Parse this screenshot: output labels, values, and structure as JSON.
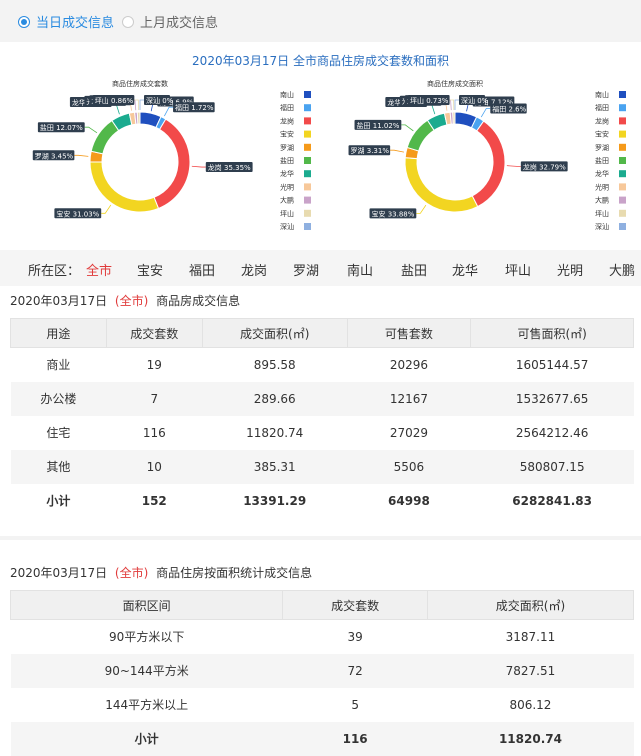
{
  "tabs": [
    {
      "label": "当日成交信息",
      "active": true
    },
    {
      "label": "上月成交信息",
      "active": false
    }
  ],
  "chart_title": "2020年03月17日 全市商品住房成交套数和面积",
  "chart_data": [
    {
      "type": "pie",
      "title": "商品住房成交套数",
      "slices": [
        {
          "name": "南山",
          "value": 6.9,
          "label": "南山 6.9%",
          "color": "#1f4fbf"
        },
        {
          "name": "福田",
          "value": 1.72,
          "label": "福田 1.72%",
          "color": "#4aa3f0"
        },
        {
          "name": "龙岗",
          "value": 35.35,
          "label": "龙岗 35.35%",
          "color": "#f24a4a"
        },
        {
          "name": "宝安",
          "value": 31.03,
          "label": "宝安 31.03%",
          "color": "#f2d521"
        },
        {
          "name": "罗湖",
          "value": 3.45,
          "label": "罗湖 3.45%",
          "color": "#f59a1a"
        },
        {
          "name": "盐田",
          "value": 12.07,
          "label": "盐田 12.07%",
          "color": "#52b84a"
        },
        {
          "name": "龙华",
          "value": 6.04,
          "label": "龙华 6.04%",
          "color": "#1bab8f"
        },
        {
          "name": "光明",
          "value": 1.72,
          "label": "光明 1.72%",
          "color": "#f7c89a"
        },
        {
          "name": "大鹏",
          "value": 0.86,
          "label": "大鹏 0.86%",
          "color": "#c9a3c9"
        },
        {
          "name": "坪山",
          "value": 0.86,
          "label": "坪山 0.86%",
          "color": "#e8dbb0"
        },
        {
          "name": "深汕",
          "value": 0,
          "label": "深汕 0%",
          "color": "#8fb0e0"
        }
      ]
    },
    {
      "type": "pie",
      "title": "商品住房成交面积",
      "slices": [
        {
          "name": "南山",
          "value": 7.12,
          "label": "南山 7.12%",
          "color": "#1f4fbf"
        },
        {
          "name": "福田",
          "value": 2.6,
          "label": "福田 2.6%",
          "color": "#4aa3f0"
        },
        {
          "name": "龙岗",
          "value": 32.79,
          "label": "龙岗 32.79%",
          "color": "#f24a4a"
        },
        {
          "name": "宝安",
          "value": 33.88,
          "label": "宝安 33.88%",
          "color": "#f2d521"
        },
        {
          "name": "罗湖",
          "value": 3.31,
          "label": "罗湖 3.31%",
          "color": "#f59a1a"
        },
        {
          "name": "盐田",
          "value": 11.02,
          "label": "盐田 11.02%",
          "color": "#52b84a"
        },
        {
          "name": "龙华",
          "value": 5.88,
          "label": "龙华 5.88%",
          "color": "#1bab8f"
        },
        {
          "name": "光明",
          "value": 1.85,
          "label": "光明 1.85%",
          "color": "#f7c89a"
        },
        {
          "name": "大鹏",
          "value": 0.82,
          "label": "大鹏 0.82%",
          "color": "#c9a3c9"
        },
        {
          "name": "坪山",
          "value": 0.73,
          "label": "坪山 0.73%",
          "color": "#e8dbb0"
        },
        {
          "name": "深汕",
          "value": 0,
          "label": "深汕 0%",
          "color": "#8fb0e0"
        }
      ]
    }
  ],
  "legend": [
    "南山",
    "福田",
    "龙岗",
    "宝安",
    "罗湖",
    "盐田",
    "龙华",
    "光明",
    "大鹏",
    "坪山",
    "深汕"
  ],
  "district_bar": {
    "label": "所在区：",
    "items": [
      "全市",
      "宝安",
      "福田",
      "龙岗",
      "罗湖",
      "南山",
      "盐田",
      "龙华",
      "坪山",
      "光明",
      "大鹏"
    ],
    "active": "全市"
  },
  "table1": {
    "date": "2020年03月17日",
    "district": "(全市)",
    "title": "商品房成交信息",
    "headers": [
      "用途",
      "成交套数",
      "成交面积(㎡)",
      "可售套数",
      "可售面积(㎡)"
    ],
    "rows": [
      [
        "商业",
        "19",
        "895.58",
        "20296",
        "1605144.57"
      ],
      [
        "办公楼",
        "7",
        "289.66",
        "12167",
        "1532677.65"
      ],
      [
        "住宅",
        "116",
        "11820.74",
        "27029",
        "2564212.46"
      ],
      [
        "其他",
        "10",
        "385.31",
        "5506",
        "580807.15"
      ]
    ],
    "total": [
      "小计",
      "152",
      "13391.29",
      "64998",
      "6282841.83"
    ]
  },
  "table2": {
    "date": "2020年03月17日",
    "district": "(全市)",
    "title": "商品住房按面积统计成交信息",
    "headers": [
      "面积区间",
      "成交套数",
      "成交面积(㎡)"
    ],
    "rows": [
      [
        "90平方米以下",
        "39",
        "3187.11"
      ],
      [
        "90~144平方米",
        "72",
        "7827.51"
      ],
      [
        "144平方米以上",
        "5",
        "806.12"
      ]
    ],
    "total": [
      "小计",
      "116",
      "11820.74"
    ]
  }
}
